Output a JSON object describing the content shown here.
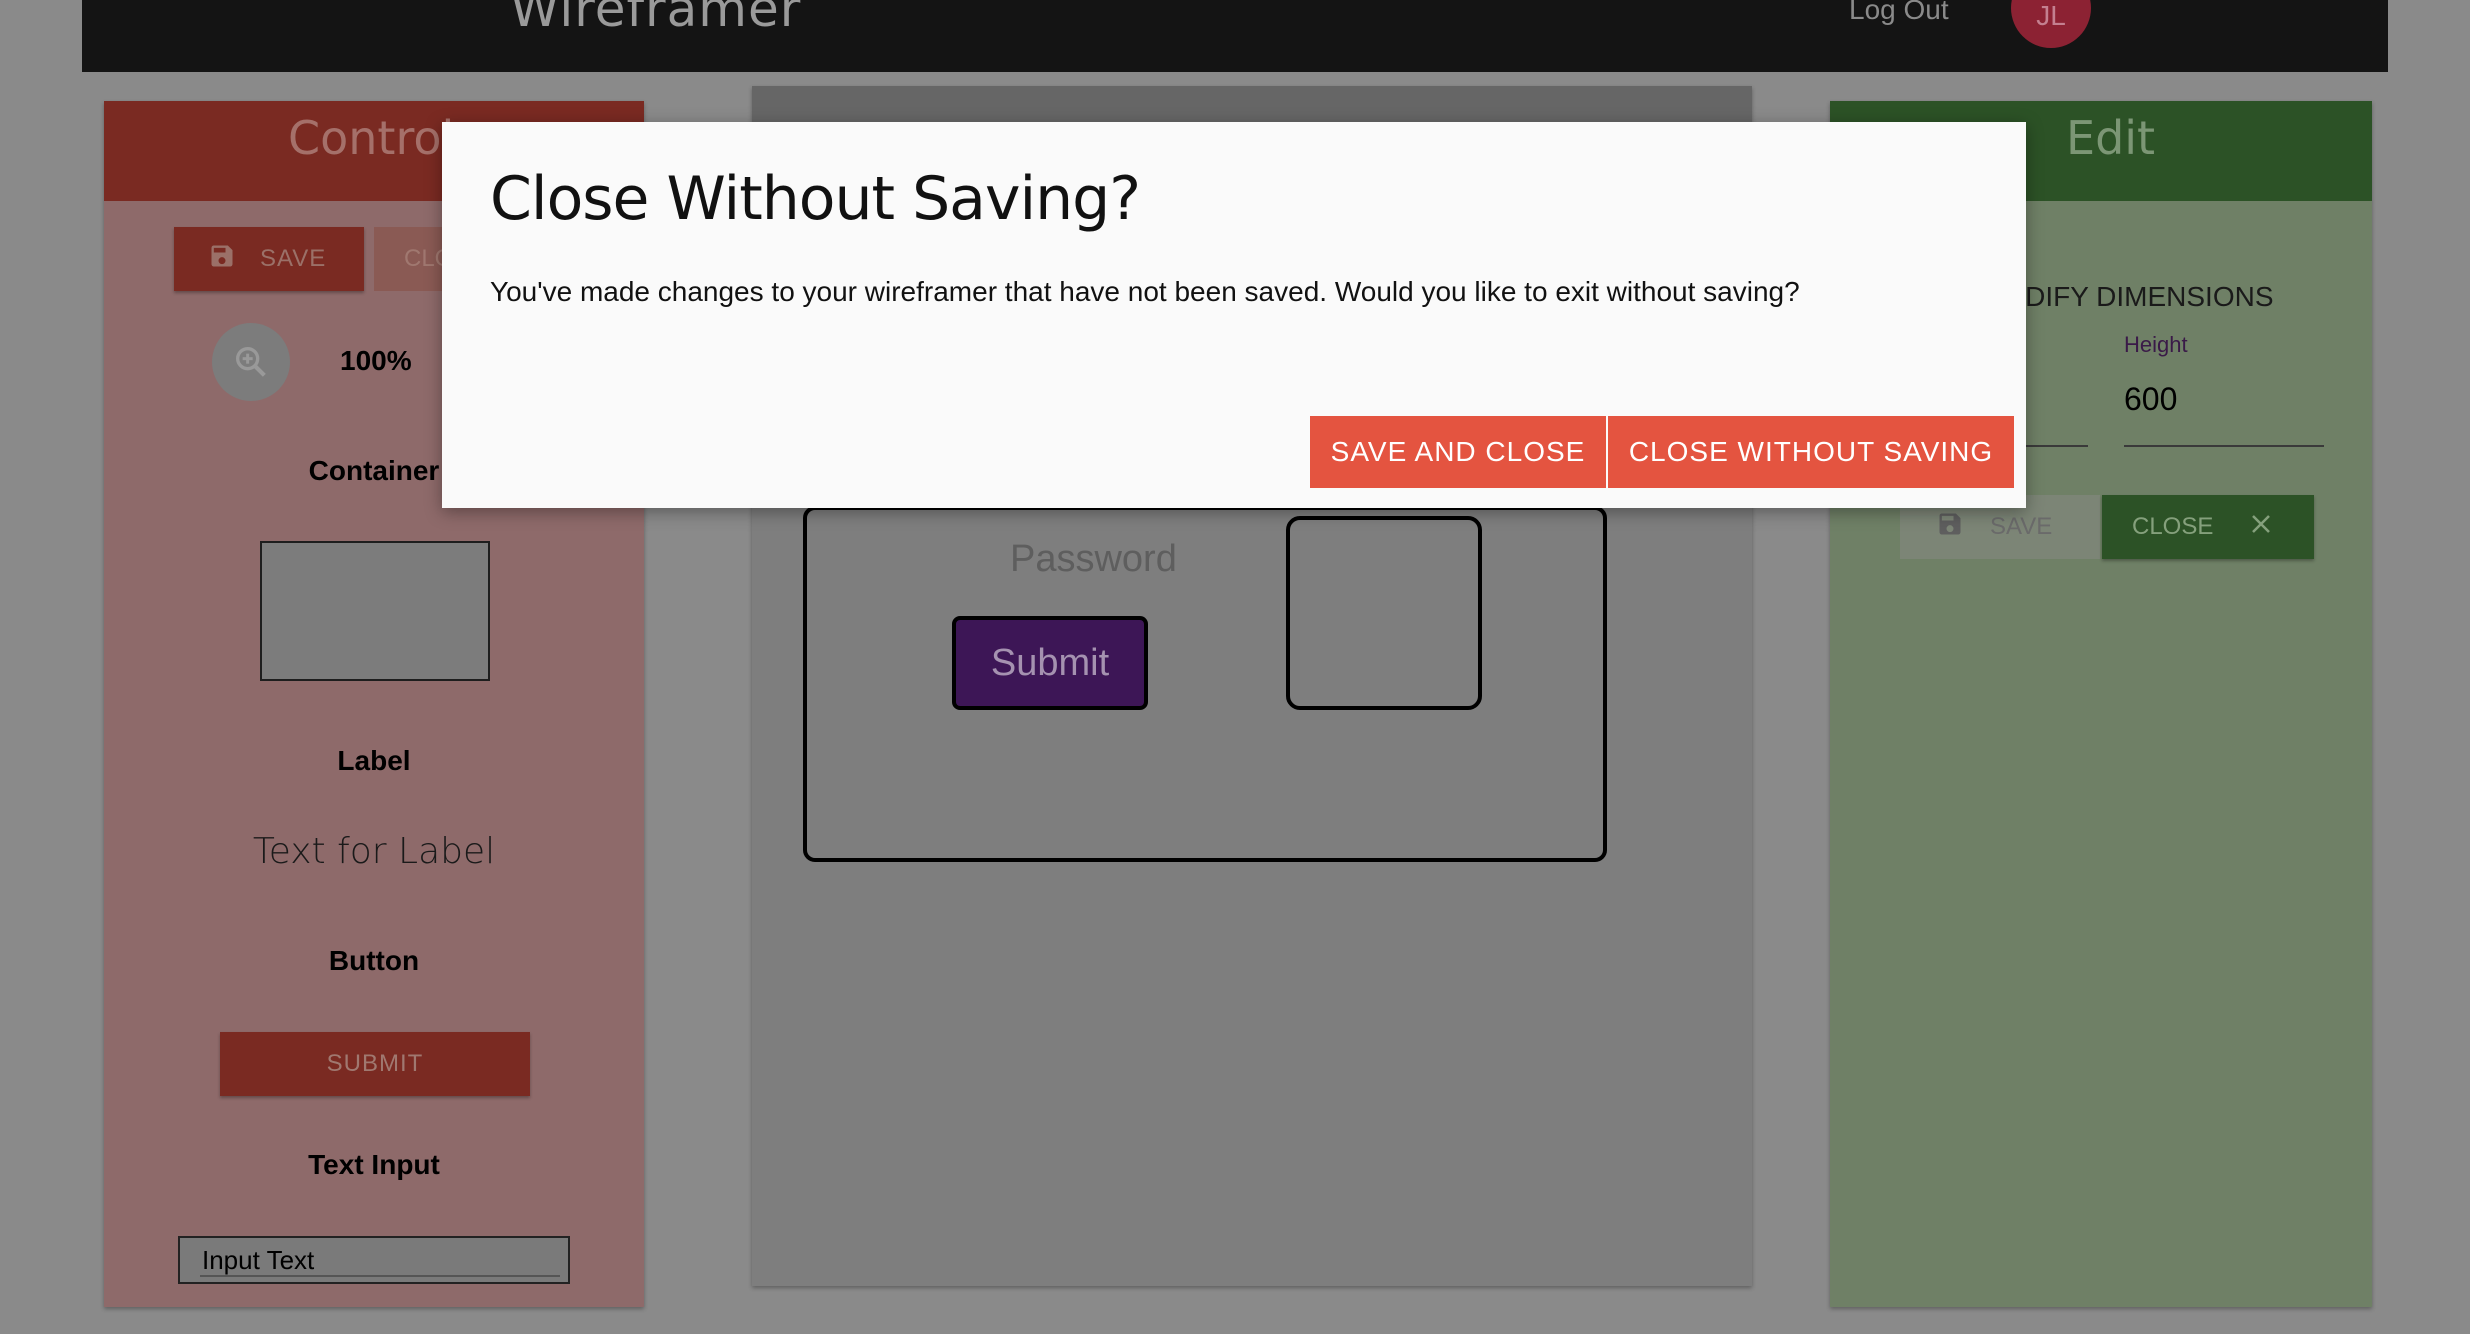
{
  "header": {
    "brand": "Wireframer",
    "logout_label": "Log Out",
    "avatar_initials": "JL"
  },
  "controls": {
    "title": "Controls",
    "save_label": "SAVE",
    "close_label": "CLOSE",
    "zoom_level": "100%",
    "container_heading": "Container",
    "label_heading": "Label",
    "label_sample": "Text for Label",
    "button_heading": "Button",
    "button_sample": "SUBMIT",
    "text_input_heading": "Text Input",
    "text_input_sample": "Input Text"
  },
  "canvas": {
    "password_text": "Password",
    "submit_text": "Submit"
  },
  "edit": {
    "title": "Edit",
    "dimensions_title": "MODIFY DIMENSIONS",
    "height_label": "Height",
    "height_value": "600",
    "save_label": "SAVE",
    "close_label": "CLOSE"
  },
  "modal": {
    "title": "Close Without Saving?",
    "body": "You've made changes to your wireframer that have not been saved. Would you like to exit without saving?",
    "save_close_label": "SAVE AND CLOSE",
    "close_nosave_label": "CLOSE WITHOUT SAVING"
  },
  "colors": {
    "modal_button": "#e45440",
    "controls_accent": "#c0392b",
    "edit_accent": "#4a8a3e",
    "wireframe_button": "#6a2a96"
  }
}
